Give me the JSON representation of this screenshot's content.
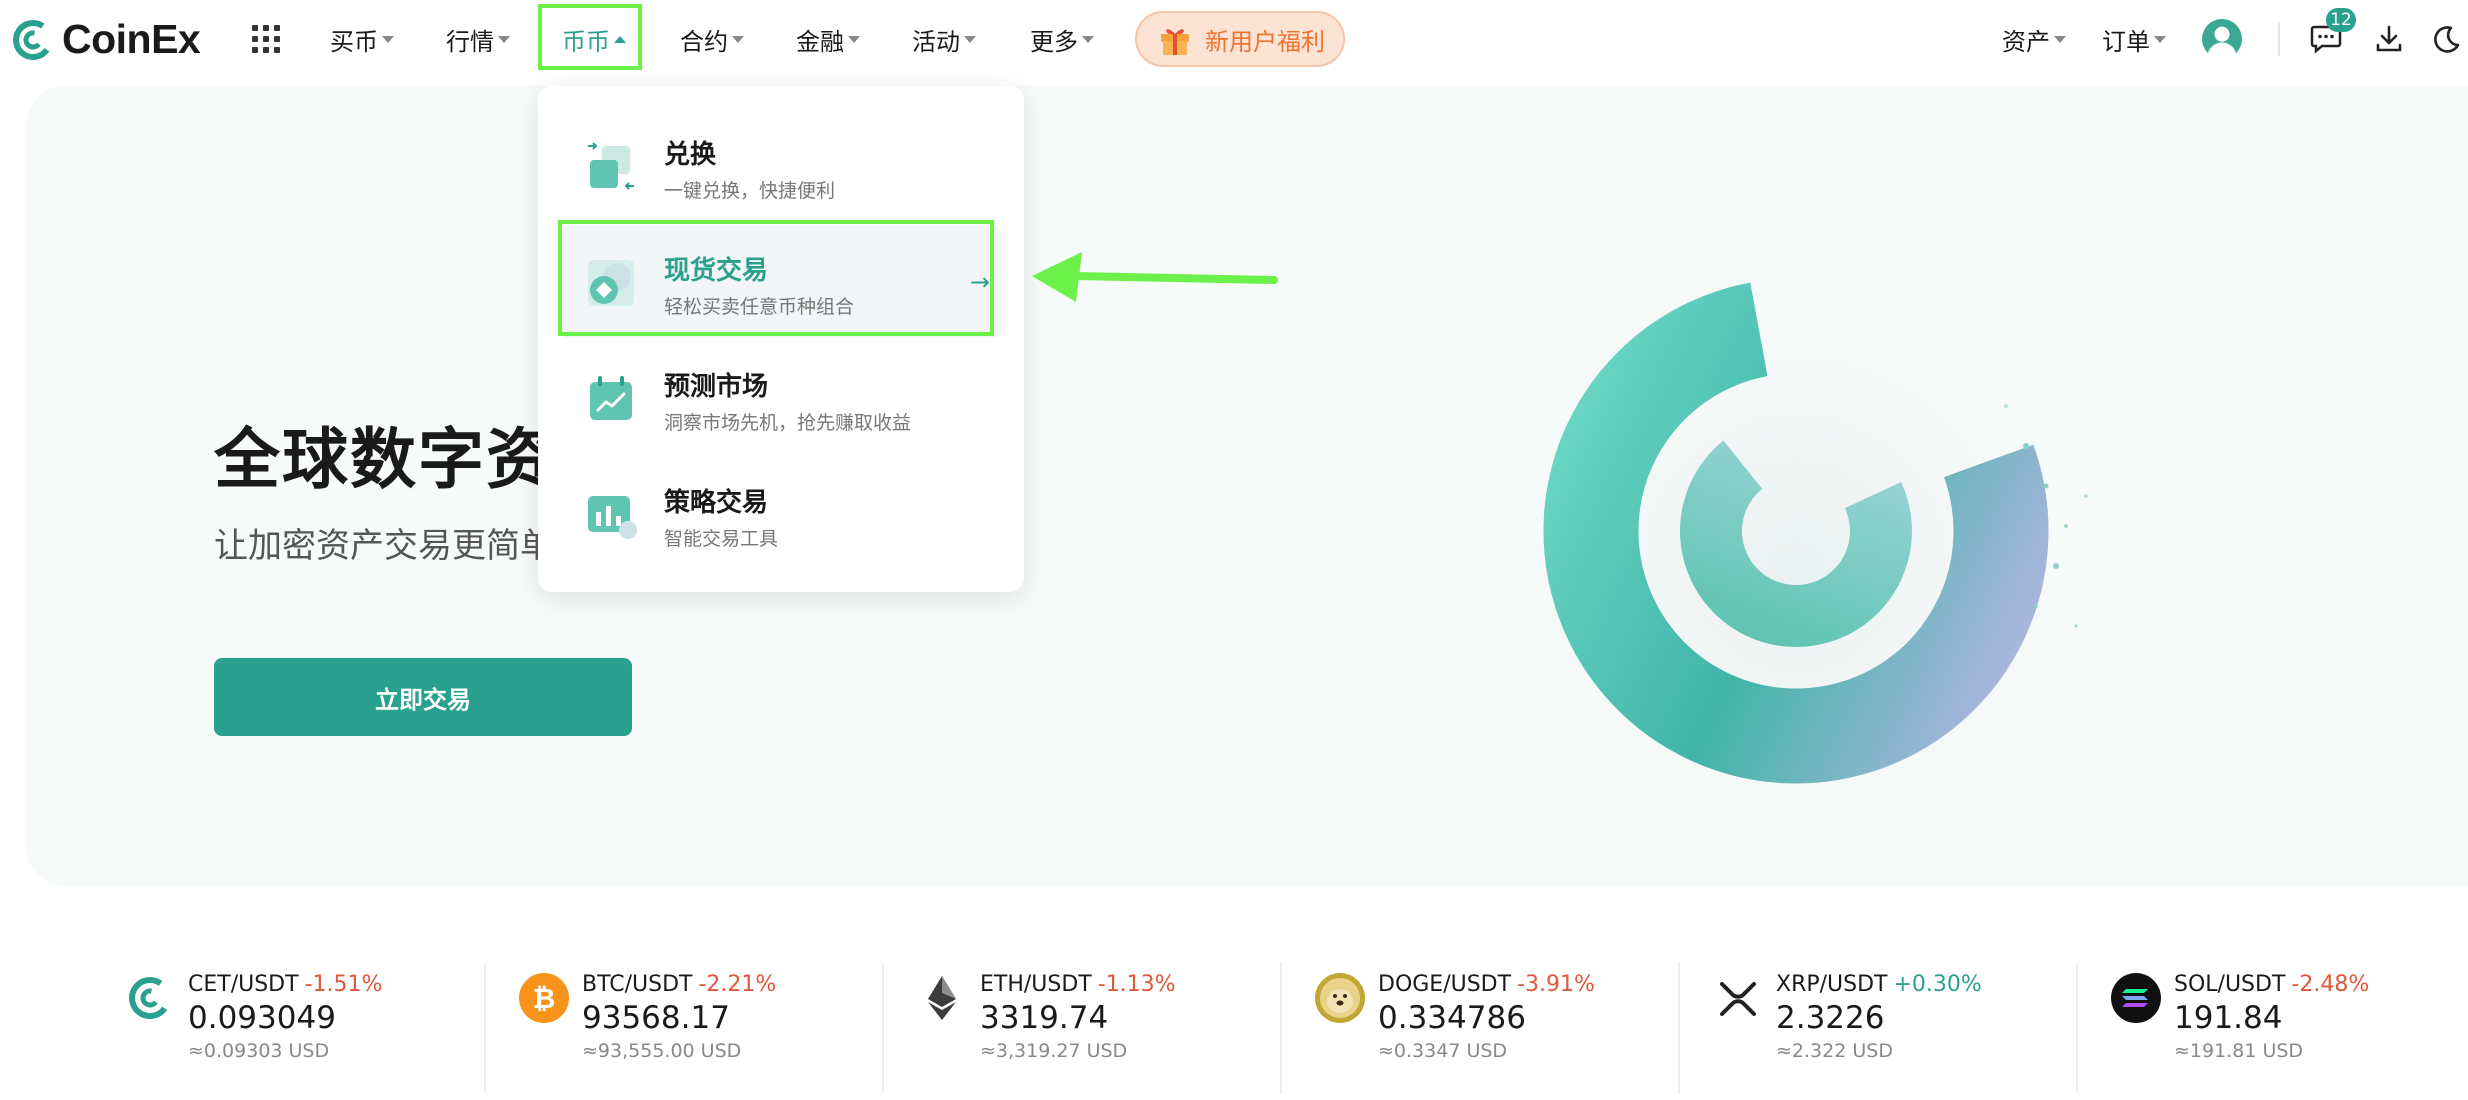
{
  "brand": {
    "name": "CoinEx"
  },
  "nav": {
    "items": [
      {
        "label": "买币"
      },
      {
        "label": "行情"
      },
      {
        "label": "币币"
      },
      {
        "label": "合约"
      },
      {
        "label": "金融"
      },
      {
        "label": "活动"
      },
      {
        "label": "更多"
      }
    ],
    "promo_label": "新用户福利",
    "assets_label": "资产",
    "orders_label": "订单",
    "message_count": "12"
  },
  "hero": {
    "title": "全球数字资产",
    "subtitle": "让加密资产交易更简单",
    "cta_label": "立即交易"
  },
  "dropdown": {
    "items": [
      {
        "title": "兑换",
        "desc": "一键兑换，快捷便利"
      },
      {
        "title": "现货交易",
        "desc": "轻松买卖任意币种组合",
        "arrow": "→"
      },
      {
        "title": "预测市场",
        "desc": "洞察市场先机，抢先赚取收益"
      },
      {
        "title": "策略交易",
        "desc": "智能交易工具"
      }
    ]
  },
  "ticker": [
    {
      "pair": "CET/USDT",
      "change": "-1.51%",
      "price": "0.093049",
      "usd": "≈0.09303 USD"
    },
    {
      "pair": "BTC/USDT",
      "change": "-2.21%",
      "price": "93568.17",
      "usd": "≈93,555.00 USD"
    },
    {
      "pair": "ETH/USDT",
      "change": "-1.13%",
      "price": "3319.74",
      "usd": "≈3,319.27 USD"
    },
    {
      "pair": "DOGE/USDT",
      "change": "-3.91%",
      "price": "0.334786",
      "usd": "≈0.3347 USD"
    },
    {
      "pair": "XRP/USDT",
      "change": "+0.30%",
      "price": "2.3226",
      "usd": "≈2.322 USD"
    },
    {
      "pair": "SOL/USDT",
      "change": "-2.48%",
      "price": "191.84",
      "usd": "≈191.81 USD"
    }
  ],
  "colors": {
    "accent": "#2aa08f",
    "down": "#e0573b",
    "up": "#2aa08f",
    "promo": "#f0742f",
    "highlight": "#6cf04a"
  },
  "icons": {
    "logo": "coinex-logo-icon",
    "apps": "apps-grid-icon",
    "gift": "gift-icon",
    "avatar": "user-avatar-icon",
    "messages": "chat-icon",
    "download": "download-icon",
    "theme": "moon-icon"
  }
}
